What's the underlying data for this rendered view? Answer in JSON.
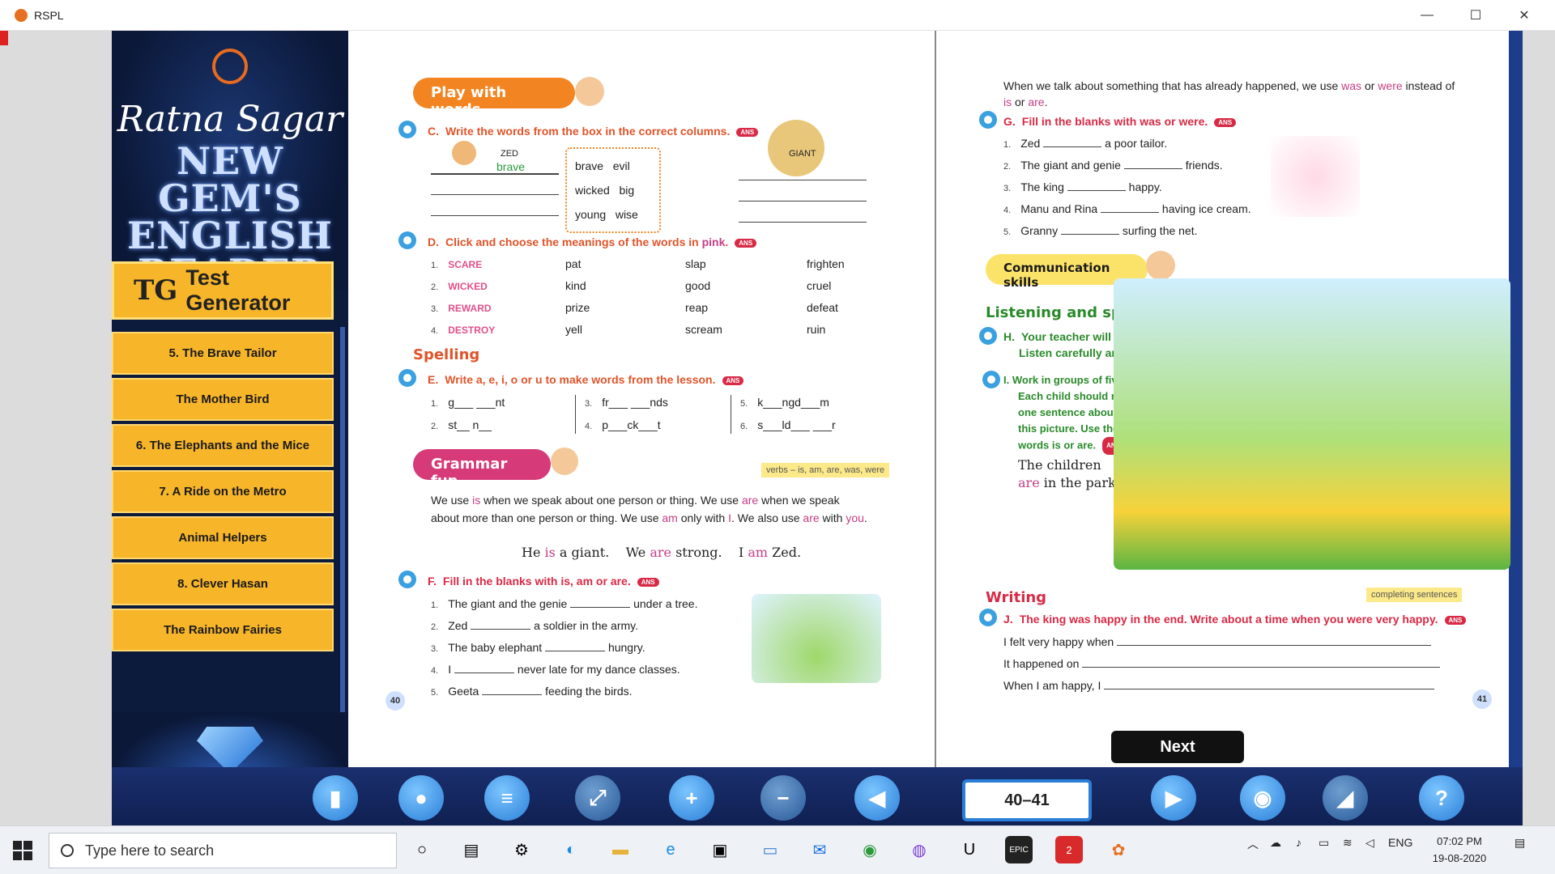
{
  "window": {
    "title": "RSPL",
    "minimize": "—",
    "maximize": "☐",
    "close": "✕"
  },
  "sidebar": {
    "publisher": "Ratna Sagar",
    "series_line1": "NEW GEM'S",
    "series_line2": "ENGLISH",
    "series_line3": "READER",
    "test_generator_icon": "TG",
    "test_generator": "Test Generator",
    "chapters": [
      "5. The Brave Tailor",
      "The Mother Bird",
      "6. The Elephants and the Mice",
      "7. A Ride on the Metro",
      "Animal Helpers",
      "8. Clever Hasan",
      "The Rainbow Fairies"
    ]
  },
  "left_page": {
    "banner_play": "Play with words",
    "qC": {
      "no": "C.",
      "text": "Write the words from the box in the correct columns."
    },
    "zed": "ZED",
    "zed_example": "brave",
    "giant": "GIANT",
    "box_words": [
      "brave",
      "evil",
      "wicked",
      "big",
      "young",
      "wise"
    ],
    "qD": {
      "no": "D.",
      "text_pre": "Click and choose the meanings of the words in ",
      "text_pink": "pink",
      "text_post": "."
    },
    "meanings": [
      {
        "n": "1.",
        "word": "SCARE",
        "a": "pat",
        "b": "slap",
        "c": "frighten"
      },
      {
        "n": "2.",
        "word": "WICKED",
        "a": "kind",
        "b": "good",
        "c": "cruel"
      },
      {
        "n": "3.",
        "word": "REWARD",
        "a": "prize",
        "b": "reap",
        "c": "defeat"
      },
      {
        "n": "4.",
        "word": "DESTROY",
        "a": "yell",
        "b": "scream",
        "c": "ruin"
      }
    ],
    "spelling": "Spelling",
    "qE": {
      "no": "E.",
      "text": "Write a, e, i, o or u to make words from the lesson."
    },
    "spell": [
      {
        "n": "1.",
        "w": "g___ ___nt"
      },
      {
        "n": "2.",
        "w": "st__ n__"
      },
      {
        "n": "3.",
        "w": "fr___ ___nds"
      },
      {
        "n": "4.",
        "w": "p___ck___t"
      },
      {
        "n": "5.",
        "w": "k___ngd___m"
      },
      {
        "n": "6.",
        "w": "s___ld___ ___r"
      }
    ],
    "banner_grammar": "Grammar fun",
    "grammar_tag": "verbs – is, am, are, was, were",
    "grammar_p1": "We use ",
    "kw_is": "is",
    "grammar_p2": " when we speak about one person or thing. We use ",
    "kw_are": "are",
    "grammar_p3": " when we speak about more than one person or thing. We use ",
    "kw_am": "am",
    "grammar_p4": " only with ",
    "kw_I": "I",
    "grammar_p5": ". We also use ",
    "kw_are2": "are",
    "grammar_p6": " with ",
    "kw_you": "you",
    "grammar_p7": ".",
    "ex1a": "He ",
    "ex1b": "is",
    "ex1c": " a giant.",
    "ex2a": "We ",
    "ex2b": "are",
    "ex2c": " strong.",
    "ex3a": "I ",
    "ex3b": "am",
    "ex3c": " Zed.",
    "qF": {
      "no": "F.",
      "text": "Fill in the blanks with is, am or are."
    },
    "fill": [
      {
        "n": "1.",
        "a": "The giant and the genie",
        "b": "under a tree."
      },
      {
        "n": "2.",
        "a": "Zed",
        "b": "a soldier in the army."
      },
      {
        "n": "3.",
        "a": "The baby elephant",
        "b": "hungry."
      },
      {
        "n": "4.",
        "a": "I",
        "b": "never late for my dance classes."
      },
      {
        "n": "5.",
        "a": "Geeta",
        "b": "feeding the birds."
      }
    ],
    "page_no": "40",
    "ans": "ANS"
  },
  "right_page": {
    "intro1": "When we talk about something that has already happened, we use ",
    "kw_was": "was",
    "intro2": " or ",
    "kw_were": "were",
    "intro3": " instead of ",
    "kw_is": "is",
    "intro4": " or ",
    "kw_are": "are",
    "intro5": ".",
    "qG": {
      "no": "G.",
      "text": "Fill in the blanks with was or were."
    },
    "fillG": [
      {
        "n": "1.",
        "a": "Zed",
        "b": "a poor tailor."
      },
      {
        "n": "2.",
        "a": "The giant and genie",
        "b": "friends."
      },
      {
        "n": "3.",
        "a": "The king",
        "b": "happy."
      },
      {
        "n": "4.",
        "a": "Manu and Rina",
        "b": "having ice cream."
      },
      {
        "n": "5.",
        "a": "Granny",
        "b": "surfing the net."
      }
    ],
    "banner_comm": "Communication skills",
    "listening": "Listening and speaking",
    "qH": {
      "no": "H.",
      "text1": "Your teacher will read out some sets of words.",
      "text2": "Listen carefully and repeat the rhyming words."
    },
    "qI": {
      "no": "I.",
      "l1": "Work in groups of five.",
      "l2": "Each child should make",
      "l3": "one sentence about",
      "l4": "this picture. Use the",
      "l5": "words is or are."
    },
    "handwriting1": "The children",
    "handwriting2a": "are",
    "handwriting2b": " in the park.",
    "writing": "Writing",
    "writing_tag": "completing sentences",
    "qJ": {
      "no": "J.",
      "text": "The king was happy in the end. Write about a time when you were very happy."
    },
    "j1": "I felt very happy when",
    "j2": "It happened on",
    "j3": "When I am happy, I",
    "page_no": "41",
    "ans": "ANS"
  },
  "next_label": "Next",
  "toolbar": {
    "page_range": "40–41",
    "icons": [
      "torch-icon",
      "microphone-icon",
      "list-icon",
      "fullscreen-icon",
      "zoom-in-icon",
      "zoom-out-icon",
      "prev-arrow-icon",
      "next-arrow-icon",
      "eye-icon",
      "megaphone-icon",
      "help-icon"
    ]
  },
  "taskbar": {
    "search_placeholder": "Type here to search",
    "lang": "ENG",
    "time": "07:02 PM",
    "date": "19-08-2020",
    "badge": "2"
  }
}
